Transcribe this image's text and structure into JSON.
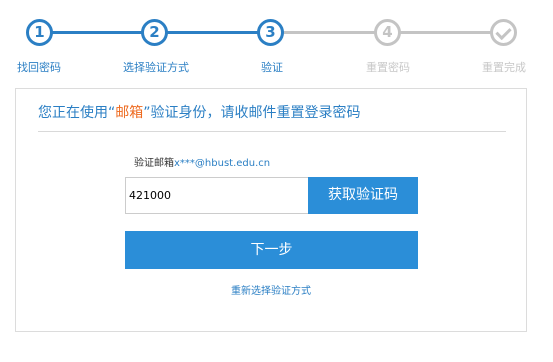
{
  "steps": [
    {
      "number": "1",
      "label": "找回密码",
      "state": "active"
    },
    {
      "number": "2",
      "label": "选择验证方式",
      "state": "active"
    },
    {
      "number": "3",
      "label": "验证",
      "state": "current"
    },
    {
      "number": "4",
      "label": "重置密码",
      "state": "inactive"
    },
    {
      "number": "",
      "label": "重置完成",
      "state": "inactive",
      "icon": "checkmark-icon"
    }
  ],
  "panel": {
    "heading_prefix": "您正在使用“",
    "heading_highlight": "邮箱",
    "heading_suffix": "”验证身份，请收邮件重置登录密码",
    "email_label": "验证邮箱",
    "email_value": "x***@hbust.edu.cn",
    "code_value": "421000",
    "get_code_label": "获取验证码",
    "next_label": "下一步",
    "reselect_label": "重新选择验证方式"
  },
  "colors": {
    "accent": "#2b7fc4",
    "button": "#2b8ed8",
    "highlight": "#ee6a1f",
    "inactive": "#c4c4c4"
  }
}
